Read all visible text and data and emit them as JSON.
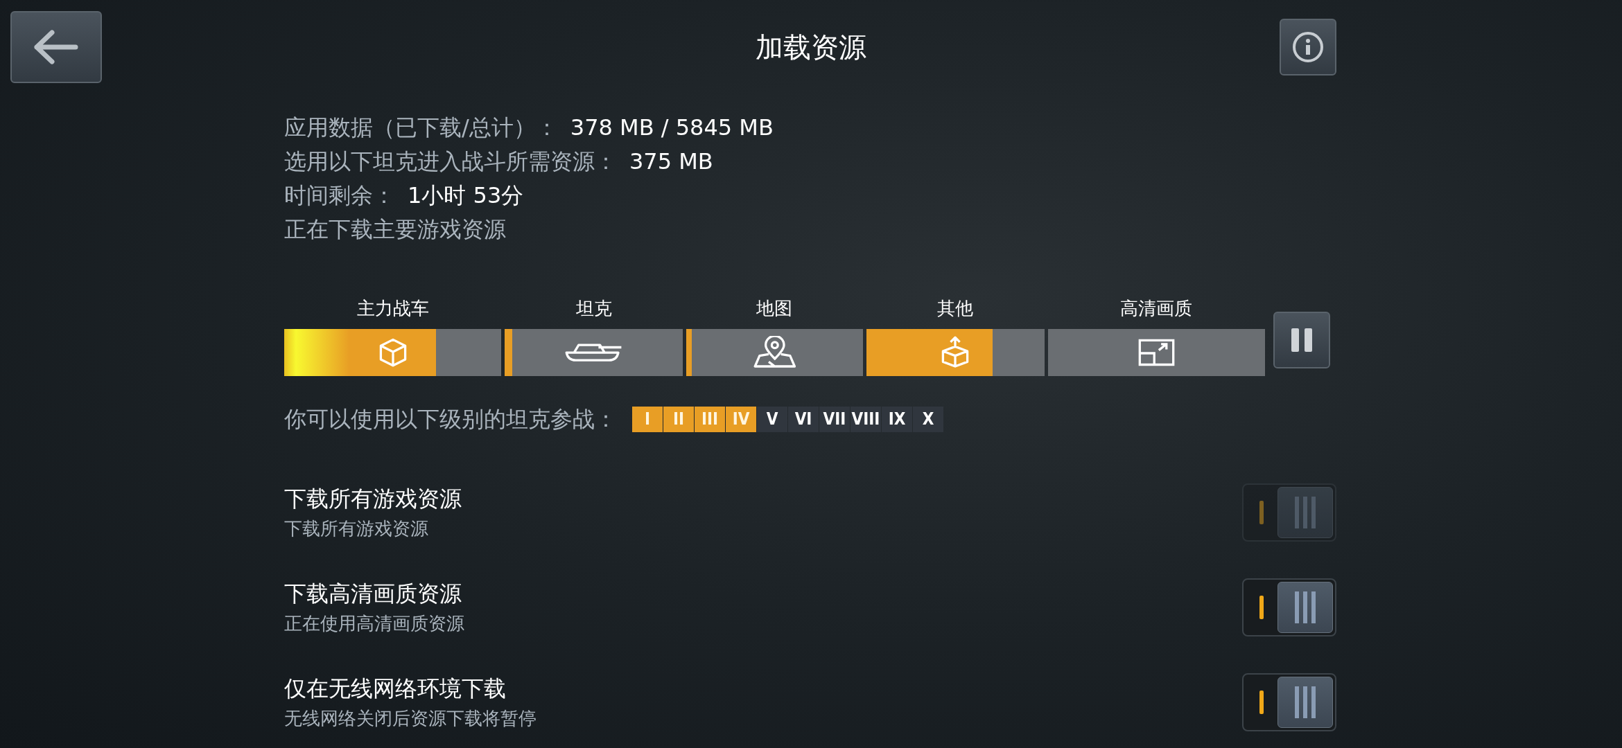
{
  "header": {
    "title": "加载资源"
  },
  "info_lines": [
    {
      "label": "应用数据（已下载/总计）：",
      "value": "378 MB / 5845 MB"
    },
    {
      "label": "选用以下坦克进入战斗所需资源：",
      "value": "375 MB"
    },
    {
      "label": "时间剩余：",
      "value": "1小时 53分"
    },
    {
      "label": "正在下载主要游戏资源"
    }
  ],
  "segments": [
    {
      "label": "主力战车",
      "kind": "cube",
      "level": 0.7,
      "active": true
    },
    {
      "label": "坦克",
      "kind": "tank",
      "level": 0.04,
      "active": false
    },
    {
      "label": "地图",
      "kind": "map",
      "level": 0.03,
      "active": false
    },
    {
      "label": "其他",
      "kind": "box-up",
      "level": 0.71,
      "active": false
    },
    {
      "label": "高清画质",
      "kind": "hd",
      "active": false
    }
  ],
  "tiers_label": "你可以使用以下级别的坦克参战：",
  "tiers": [
    {
      "label": "I",
      "available": true
    },
    {
      "label": "II",
      "available": true
    },
    {
      "label": "III",
      "available": true
    },
    {
      "label": "IV",
      "available": true
    },
    {
      "label": "V",
      "available": false
    },
    {
      "label": "VI",
      "available": false
    },
    {
      "label": "VII",
      "available": false
    },
    {
      "label": "VIII",
      "available": false
    },
    {
      "label": "IX",
      "available": false
    },
    {
      "label": "X",
      "available": false
    }
  ],
  "settings": [
    {
      "title": "下载所有游戏资源",
      "subtitle": "下载所有游戏资源",
      "on": true,
      "disabled": true
    },
    {
      "title": "下载高清画质资源",
      "subtitle": "正在使用高清画质资源",
      "on": true,
      "disabled": false
    },
    {
      "title": "仅在无线网络环境下载",
      "subtitle": "无线网络关闭后资源下载将暂停",
      "on": true,
      "disabled": false
    }
  ]
}
